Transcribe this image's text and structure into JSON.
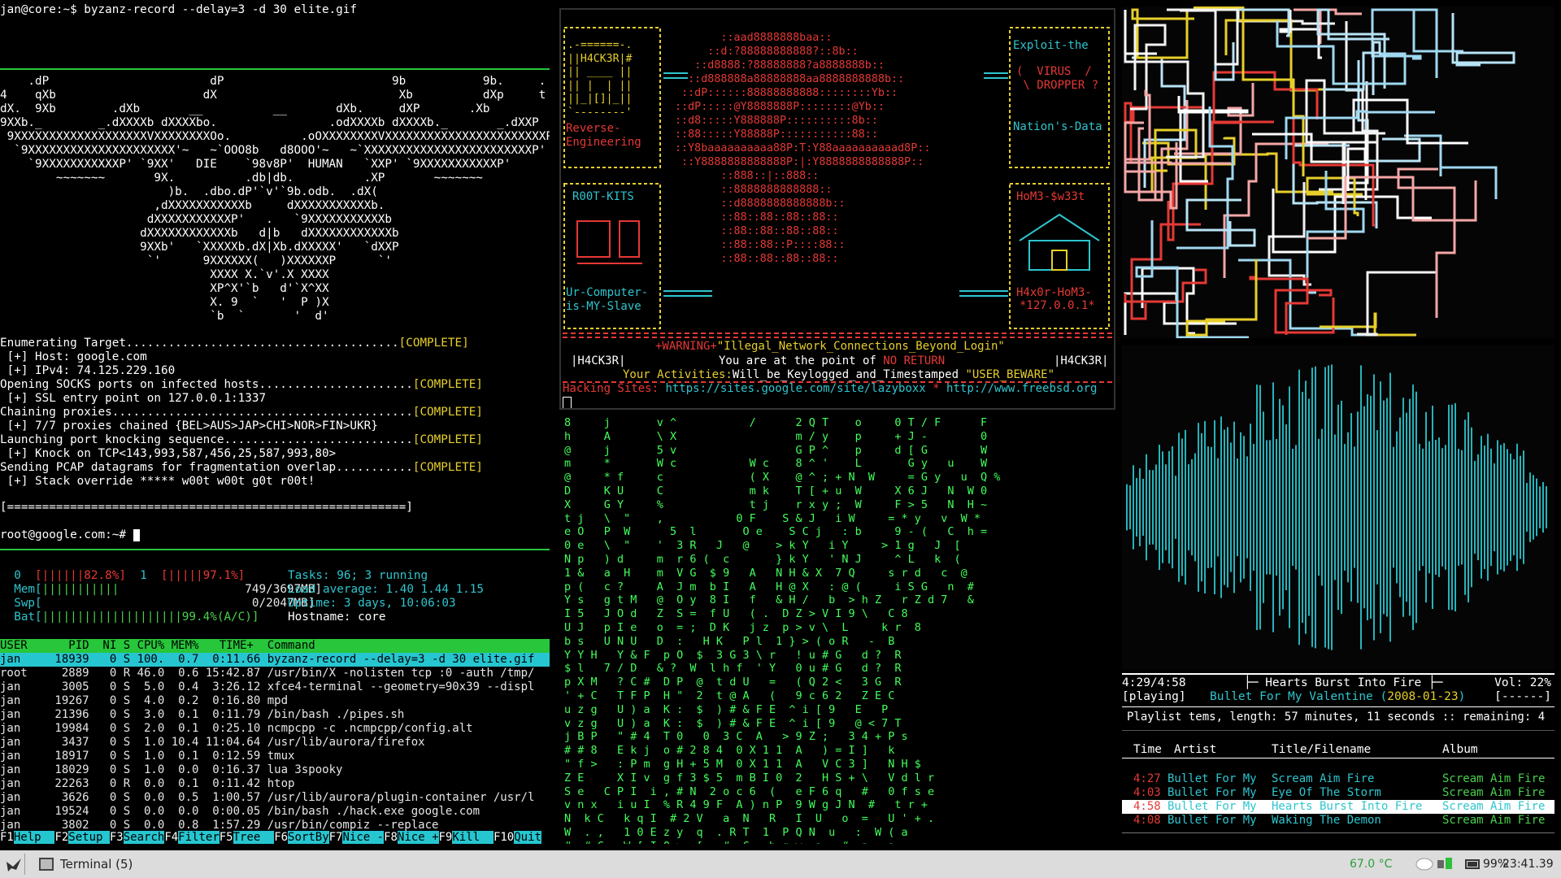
{
  "left": {
    "prompt1": "jan@core:~$ byzanz-record --delay=3 -d 30 elite.gif",
    "art": [
      "    .dP                       dP                        9b           9b.     .",
      "4    qXb                     dX                          Xb          dXp     t",
      "dX.  9Xb        .dXb       __          __       dXb.     dXP       .Xb",
      "9XXb._        _.dXXXXb dXXXXbo.                .odXXXXb dXXXXb._       _.dXXP",
      " 9XXXXXXXXXXXXXXXXXXXVXXXXXXXXOo.          .oOXXXXXXXXVXXXXXXXXXXXXXXXXXXXXXXXP",
      "  `9XXXXXXXXXXXXXXXXXXXXX'~   ~`OOO8b   d8OOO'~   ~`XXXXXXXXXXXXXXXXXXXXXXXXP'",
      "    `9XXXXXXXXXXXP' `9XX'   DIE    `98v8P'  HUMAN   `XXP' `9XXXXXXXXXXXP'",
      "        ~~~~~~~       9X.          .db|db.          .XP       ~~~~~~~",
      "                        )b.  .dbo.dP'`v'`9b.odb.  .dX(",
      "                      ,dXXXXXXXXXXXb     dXXXXXXXXXXXb.",
      "                     dXXXXXXXXXXXP'   .   `9XXXXXXXXXXXb",
      "                    dXXXXXXXXXXXXb   d|b   dXXXXXXXXXXXXb",
      "                    9XXb'   `XXXXXb.dX|Xb.dXXXXX'   `dXXP",
      "                     `'      9XXXXXX(   )XXXXXXP      `'",
      "                              XXXX X.`v'.X XXXX",
      "                              XP^X'`b   d'`X^XX",
      "                              X. 9  `   '  P )X",
      "                              `b  `       '  d'"
    ],
    "status_lines": [
      {
        "text": "Enumerating Target.......................................",
        "badge": "[COMPLETE]"
      },
      {
        "text": " [+] Host: google.com",
        "badge": ""
      },
      {
        "text": " [+] IPv4: 74.125.229.160",
        "badge": ""
      },
      {
        "text": "Opening SOCKS ports on infected hosts......................",
        "badge": "[COMPLETE]"
      },
      {
        "text": " [+] SSL entry point on 127.0.0.1:1337",
        "badge": ""
      },
      {
        "text": "Chaining proxies...........................................",
        "badge": "[COMPLETE]"
      },
      {
        "text": " [+] 7/7 proxies chained {BEL>AUS>JAP>CHI>NOR>FIN>UKR}",
        "badge": ""
      },
      {
        "text": "Launching port knocking sequence...........................",
        "badge": "[COMPLETE]"
      },
      {
        "text": " [+] Knock on TCP<143,993,587,456,25,587,993,80>",
        "badge": ""
      },
      {
        "text": "Sending PCAP datagrams for fragmentation overlap...........",
        "badge": "[COMPLETE]"
      },
      {
        "text": " [+] Stack override ***** w00t w00t g0t r00t!",
        "badge": ""
      }
    ],
    "progress": "[=========================================================]",
    "prompt2": "root@google.com:~# ",
    "htop": {
      "cpu0_label": "0",
      "cpu0_bar": "[||||||82.8%]",
      "cpu1_label": "1",
      "cpu1_bar": "[|||||97.1%]",
      "mem_label": "Mem[",
      "mem_bar": "|||||||||||",
      "mem_value": "749/3697MB]",
      "swp_label": "Swp[",
      "swp_value": "0/2047MB]",
      "bat_label": "Bat[",
      "bat_bar": "||||||||||||||||||||99.4%(A/C)]",
      "tasks": "Tasks: 96; 3 running",
      "load": "Load average: 1.40 1.44 1.15",
      "uptime": "Uptime: 3 days, 10:06:03",
      "hostname": "Hostname: core",
      "header": "USER      PID  NI S CPU% MEM%   TIME+  Command",
      "selected": "jan     18939   0 S 100.  0.7  0:11.66 byzanz-record --delay=3 -d 30 elite.gif",
      "rows": [
        "root     2889   0 R 46.0  0.6 15:42.87 /usr/bin/X -nolisten tcp :0 -auth /tmp/",
        "jan      3005   0 S  5.0  0.4  3:26.12 xfce4-terminal --geometry=90x39 --displ",
        "jan     19267   0 S  4.0  0.2  0:16.80 mpd",
        "jan     21396   0 S  3.0  0.1  0:11.79 /bin/bash ./pipes.sh",
        "jan     19984   0 S  2.0  0.1  0:25.10 ncmpcpp -c .ncmpcpp/config.alt",
        "jan      3437   0 S  1.0 10.4 11:04.64 /usr/lib/aurora/firefox",
        "jan     18917   0 S  1.0  0.1  0:12.59 tmux",
        "jan     18029   0 S  1.0  0.0  0:16.37 lua 3spooky",
        "jan     22263   0 R  0.0  0.1  0:11.42 htop",
        "jan      3626   0 S  0.0  0.5  1:00.57 /usr/lib/aurora/plugin-container /usr/l",
        "jan     19524   0 S  0.0  0.0  0:00.05 /bin/bash ./hack.exe google.com",
        "jan      3802   0 S  0.0  0.8  1:57.29 /usr/bin/compiz --replace"
      ],
      "fkeys": [
        {
          "key": "F1",
          "label": "Help  "
        },
        {
          "key": "F2",
          "label": "Setup "
        },
        {
          "key": "F3",
          "label": "Search"
        },
        {
          "key": "F4",
          "label": "Filter"
        },
        {
          "key": "F5",
          "label": "Tree  "
        },
        {
          "key": "F6",
          "label": "SortBy"
        },
        {
          "key": "F7",
          "label": "Nice -"
        },
        {
          "key": "F8",
          "label": "Nice +"
        },
        {
          "key": "F9",
          "label": "Kill  "
        },
        {
          "key": "F10",
          "label": "Quit"
        }
      ]
    }
  },
  "ascii_panel": {
    "left_top": ".-======-.\n||H4CK3R|#\n|| ____ ||\n|| |  | ||\n||_|[]|_||\n`--------'",
    "left_mid_label": "Reverse-\nEngineering",
    "rootkits_label": "R00T-KITS",
    "slave_label": "Ur-Computer-\nis-MY-Slave",
    "right_top": "Exploit-the",
    "virus": "(  VIRUS  /\n \\ DROPPER ?",
    "nations": "Nation's-Data",
    "home": "HoM3-$w33t",
    "h4x0r": "H4x0r-HoM3-",
    "localhost": "*127.0.0.1*",
    "skull": "       ::aad8888888baa::\n     ::d:?88888888888?::8b::\n   ::d8888:?88888888?a8888888b::\n  ::d888888a88888888aa8888888888b::\n ::dP::::::88888888888::::::::Yb::\n::dP:::::@Y8888888P::::::::@Yb::\n::d8:::::Y888888P::::::::::8b::\n::88:::::Y88888P:::::::::::88::\n::Y8baaaaaaaaaa88P:T:Y88aaaaaaaaaad8P::\n ::Y8888888888888P:|:Y8888888888888P::\n       ::888::|::888::\n       ::8888888888888::\n       ::d8888888888888b::\n       ::88::88::88::88::\n       ::88::88::88::88::\n       ::88::88::P::::88::\n       ::88::88::88::88::",
    "warning_tag": "+WARNING+",
    "warning": "\"Illegal_Network_Connections_Beyond_Login\"",
    "h4ck3r_tag": "|H4CK3R|",
    "point_prefix": "You are at the point of ",
    "no_return": "NO RETURN",
    "keylog_prefix": "Your Activities:",
    "keylog": "Will_be_Keylogged_and_Timestamped",
    "user_beware": "\"USER_BEWARE\"",
    "sites_label": "Hacking Sites: ",
    "site1": "https://sites.google.com/site/lazyboxx",
    "site_sep": " * ",
    "site2": "http://www.freebsd.org"
  },
  "matrix": {
    "columns": "8     j       v ^           /      2 Q T    o     0 T / F      F\nh     A       \\ X                  m / y    p     + J -        0\n@     j       5 v                  G P ^    p     d [ G        W\nm     *       W c           W c    8 ^ '    L       G y   u    W\n@     * f     c             ( X    @ ^ ; + N  W     = G y   u  Q %\nD     K U     C             m k    T [ + u  W     X 6 J   N  W 0\nX     G Y     %             t j    r x y ;  W     F > 5   N  H ~\nt j   \\  \"    ,           0 F    S & J   i W     = * y   v  W *\ne O   P  W      5  l       O e    S C j   : b     9 - (   C  h =\n0 e   \\  \"    '  3 R   J   @    > k Y   i Y     > 1 g   J  [\nN p   ) d     m  r 6 (  c       } k Y   ' N J     ^ L   k  (\n1 &   a  H    m  V G  $ 9   A   N H & X  7 Q     s r d   c  @\np (   c ?     A  J m  b I   A   H @ X   : @ (     i S G   n  #\nY s   g t M   @  O y  8 I   f   & H /   b  > h Z   r Z d 7   &\nI 5   J O d   Z  S =  f U   ( .  D Z > V I 9 \\   C 8\nU J   p I e   o  = ;  D K   j z  p > v \\  L     k r  8\nb s   U N U   D  :   H K   P l  1 } > ( o R   -  B\nY Y H   Y & F  p O  $  3 G 3 \\ r   ! u # G   d ?  R\n$ l   7 / D   & ?  W  l h f  ' Y   0 u # G   d ?  R\np X M   ? C #  D P  @  t d U   =   ( Q 2 <   3 G  R\n' + C   T F P  H \"  2  t @ A   (   9 c 6 2   Z E C\nu z g   U ) a  K :  $  ) # & F E  ^ i [ 9   E   P\nv z g   U ) a  K :  $  ) # & F E  ^ i [ 9   @ < 7 T\nj B P   \" # 4  T 0   0  3 C  A   > 9 Z ;   3 4 + P s\n# # 8   E k j  o # 2 8 4  0 X 1 1  A   ) = I ]   k\n\" f >   : P m  g H + 5 M  0 X 1 1  A   V C 3 ]   N H $\nZ E     X I v  g f 3 $ 5  m B I 0  2   H S + \\   V d l r\nS e   C P I  i , # N  2 o c 6  (   e F 6 q   #   0 f s e\nv n x   i u I  % R 4 9 F  A ) n P  9 W g J N  #   t r +\nN  k C   k q I  # 2 V   a  N   R   I  U   o  =   U ' + .\nW  . ,   1 0 E z y  q  . R T  1  P Q N  u   :  W ( a\n#  # C   W [ I Q >  [ = #  C   h g w  a   #  a   a"
  },
  "ncmpcpp": {
    "time": "4:29/4:58",
    "now_playing_title": "Hearts Burst Into Fire",
    "vol": "Vol: 22%",
    "state": "[playing]",
    "now_playing_album": "Bullet For My Valentine (",
    "now_playing_date": "2008-01-23",
    "now_playing_close": ")",
    "flags": "[------]",
    "playlist_info": "Playlist tems, length: 57 minutes, 11 seconds :: remaining: 4",
    "col_time": "Time",
    "col_artist": "Artist",
    "col_title": "Title/Filename",
    "col_album": "Album",
    "tracks": [
      {
        "time": "4:27",
        "artist": "Bullet For My",
        "title": "Scream Aim Fire",
        "album": "Scream Aim Fire",
        "selected": false
      },
      {
        "time": "4:03",
        "artist": "Bullet For My",
        "title": "Eye Of The Storm",
        "album": "Scream Aim Fire",
        "selected": false
      },
      {
        "time": "4:58",
        "artist": "Bullet For My",
        "title": "Hearts Burst Into Fire",
        "album": "Scream Aim Fire",
        "selected": true
      },
      {
        "time": "4:08",
        "artist": "Bullet For My",
        "title": "Waking The Demon",
        "album": "Scream Aim Fire",
        "selected": false
      }
    ]
  },
  "taskbar": {
    "app_label": "Terminal (5)",
    "temp": "67.0 °C",
    "battery": "99%",
    "clock": "23:41.39"
  },
  "colors": {
    "accent_green": "#28c63b",
    "accent_cyan": "#26c6d0",
    "skull_red": "#e53935",
    "ascii_yellow": "#e7cf2b",
    "matrix_green": "#42ff5a",
    "viz_teal": "#26b3ba"
  },
  "icons": [
    "menu-bird-icon",
    "terminal-icon",
    "network-icon",
    "battery-icon"
  ]
}
